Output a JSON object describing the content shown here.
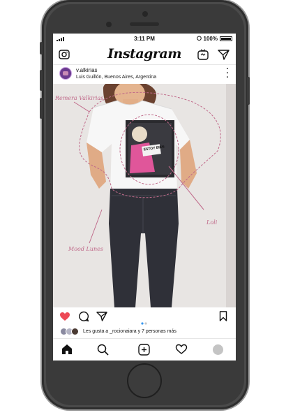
{
  "status": {
    "time": "3:11 PM",
    "battery": "100%"
  },
  "app": {
    "title": "Instagram"
  },
  "post": {
    "username": "v.alkirias",
    "location": "Luis Guillón, Buenos Aires, Argentina",
    "tshirt_print": "ESTOY BIEN",
    "annotations": {
      "shirt": "Remera Valkirias",
      "print": "Loli",
      "jeans": "Mood Lunes"
    },
    "likes_text": "Les gusta a _rocionaiara y 7 personas más"
  },
  "colors": {
    "heart": "#ed4956",
    "annotation": "#c06a8a",
    "carousel_active": "#3897f0"
  },
  "icons": {
    "top_left": "camera-icon",
    "top_right": [
      "igtv-icon",
      "direct-message-icon"
    ],
    "actions": [
      "heart-icon",
      "comment-icon",
      "share-icon",
      "bookmark-icon"
    ],
    "nav": [
      "home-icon",
      "search-icon",
      "add-post-icon",
      "activity-heart-icon",
      "profile-icon"
    ]
  }
}
